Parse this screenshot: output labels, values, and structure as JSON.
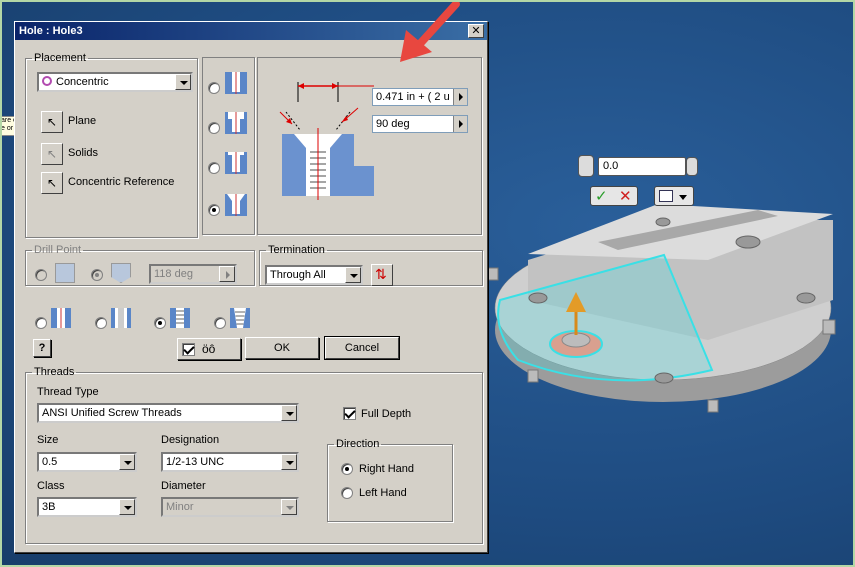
{
  "dialog": {
    "title": "Hole : Hole3",
    "close_glyph": "✕"
  },
  "placement": {
    "legend": "Placement",
    "mode": "Concentric",
    "items": [
      {
        "label": "Plane"
      },
      {
        "label": "Solids"
      },
      {
        "label": "Concentric Reference"
      }
    ]
  },
  "preview": {
    "diameter": "0.471 in + ( 2 u",
    "angle": "90 deg"
  },
  "drill_point": {
    "legend": "Drill Point",
    "angle": "118 deg"
  },
  "termination": {
    "legend": "Termination",
    "value": "Through All"
  },
  "buttons": {
    "ok": "OK",
    "cancel": "Cancel",
    "help": "?",
    "preview_glyph": "öô"
  },
  "threads": {
    "legend": "Threads",
    "thread_type_label": "Thread Type",
    "thread_type": "ANSI Unified Screw Threads",
    "full_depth": "Full Depth",
    "size_label": "Size",
    "size": "0.5",
    "designation_label": "Designation",
    "designation": "1/2-13 UNC",
    "class_label": "Class",
    "class": "3B",
    "diameter_label": "Diameter",
    "diameter": "Minor",
    "direction_legend": "Direction",
    "right_hand": "Right Hand",
    "left_hand": "Left Hand"
  },
  "viewport": {
    "mini_value": "0.0",
    "tip_text": "are c e or"
  },
  "colors": {
    "title_start": "#0a246a",
    "title_end": "#3a6ea5",
    "dialog_bg": "#d4d0c8",
    "viewport_bg": "#1f4e82",
    "part_gray": "#c8c8c8",
    "highlight": "#39e0e6",
    "arrow_red": "#e8473f"
  }
}
